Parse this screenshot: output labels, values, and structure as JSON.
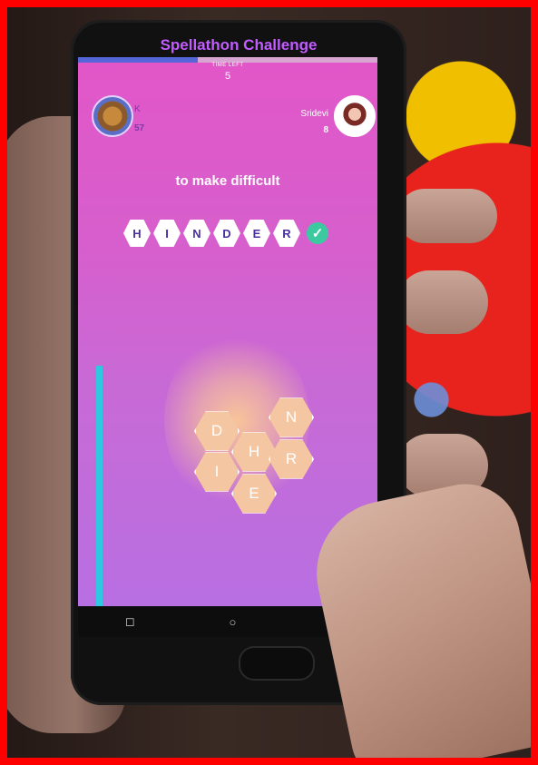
{
  "app": {
    "title": "Spellathon Challenge"
  },
  "timer": {
    "label": "TIME LEFT",
    "value": "5",
    "progress_fraction": 0.4
  },
  "players": {
    "left": {
      "name": "K",
      "score": "57",
      "avatar_icon": "avatar-icon"
    },
    "right": {
      "name": "Sridevi",
      "score": "8",
      "avatar_icon": "avatar-icon"
    }
  },
  "clue": "to make difficult",
  "answer": {
    "letters": [
      "H",
      "I",
      "N",
      "D",
      "E",
      "R"
    ],
    "status_icon": "check-icon",
    "status_symbol": "✓"
  },
  "board": {
    "letters": [
      "D",
      "N",
      "H",
      "I",
      "R",
      "E"
    ]
  },
  "nav": {
    "back": "◻",
    "home": "○"
  },
  "colors": {
    "accent": "#c25cff",
    "screen_top": "#e256c8",
    "screen_bottom": "#b86fe2",
    "progress": "#5566d8",
    "check": "#3cc9a0"
  }
}
